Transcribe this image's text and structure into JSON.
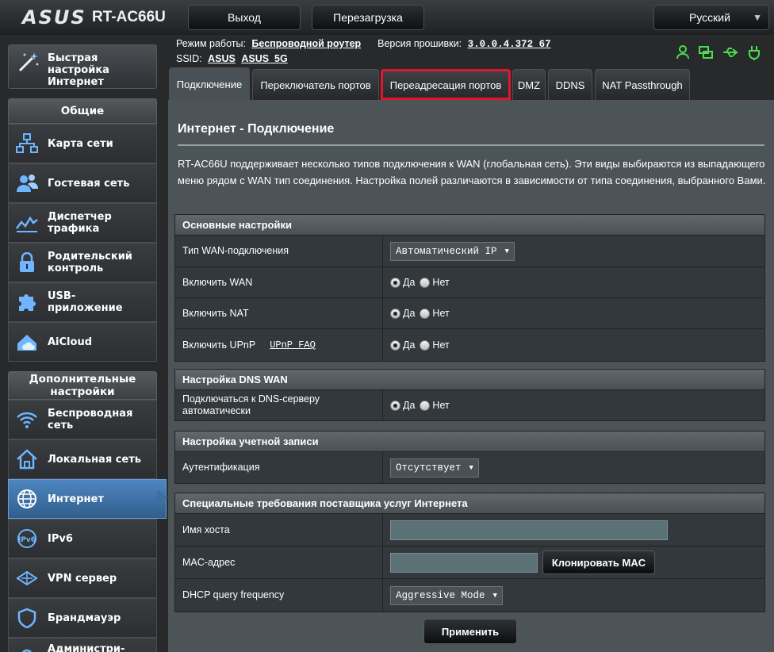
{
  "header": {
    "logo": "ASUS",
    "model": "RT-AC66U",
    "logout_label": "Выход",
    "reboot_label": "Перезагрузка",
    "language": "Русский"
  },
  "info": {
    "mode_label": "Режим работы:",
    "mode_value": "Беспроводной роутер",
    "firmware_label": "Версия прошивки:",
    "firmware_value": "3.0.0.4.372_67",
    "ssid_label": "SSID:",
    "ssid_1": "ASUS",
    "ssid_2": "ASUS_5G"
  },
  "sidebar": {
    "quick_setup": "Быстрая настройка Интернет",
    "general_header": "Общие",
    "advanced_header": "Дополнительные настройки",
    "general_items": [
      {
        "label": "Карта сети"
      },
      {
        "label": "Гостевая сеть"
      },
      {
        "label": "Диспетчер трафика"
      },
      {
        "label": "Родительский контроль"
      },
      {
        "label": "USB-приложение"
      },
      {
        "label": "AiCloud"
      }
    ],
    "advanced_items": [
      {
        "label": "Беспроводная сеть"
      },
      {
        "label": "Локальная сеть"
      },
      {
        "label": "Интернет"
      },
      {
        "label": "IPv6"
      },
      {
        "label": "VPN сервер"
      },
      {
        "label": "Брандмауэр"
      },
      {
        "label": "Администри-"
      }
    ]
  },
  "tabs": [
    {
      "label": "Подключение"
    },
    {
      "label": "Переключатель портов"
    },
    {
      "label": "Переадресация портов"
    },
    {
      "label": "DMZ"
    },
    {
      "label": "DDNS"
    },
    {
      "label": "NAT Passthrough"
    }
  ],
  "main": {
    "title": "Интернет - Подключение",
    "description": "RT-AC66U поддерживает несколько типов подключения к WAN (глобальная сеть). Эти виды выбираются из выпадающего меню рядом с WAN тип соединения. Настройка полей различаются в зависимости от типа соединения, выбранного Вами.",
    "yes": "Да",
    "no": "Нет",
    "basic": {
      "header": "Основные настройки",
      "wan_type_label": "Тип WAN-подключения",
      "wan_type_value": "Автоматический IP",
      "enable_wan_label": "Включить WAN",
      "enable_nat_label": "Включить NAT",
      "enable_upnp_label": "Включить UPnP",
      "upnp_faq": "UPnP FAQ"
    },
    "dns": {
      "header": "Настройка DNS WAN",
      "auto_dns_label": "Подключаться к DNS-серверу автоматически"
    },
    "account": {
      "header": "Настройка учетной записи",
      "auth_label": "Аутентификация",
      "auth_value": "Отсутствует"
    },
    "isp": {
      "header": "Специальные требования поставщика услуг Интернета",
      "hostname_label": "Имя хоста",
      "hostname_value": "",
      "mac_label": "MAC-адрес",
      "mac_value": "",
      "clone_mac_label": "Клонировать MAC",
      "dhcp_label": "DHCP query frequency",
      "dhcp_value": "Aggressive Mode"
    },
    "apply_label": "Применить"
  },
  "colors": {
    "highlight": "#e3142c",
    "active_nav": "#3d6fa1",
    "status_green": "#4cdc4c"
  }
}
